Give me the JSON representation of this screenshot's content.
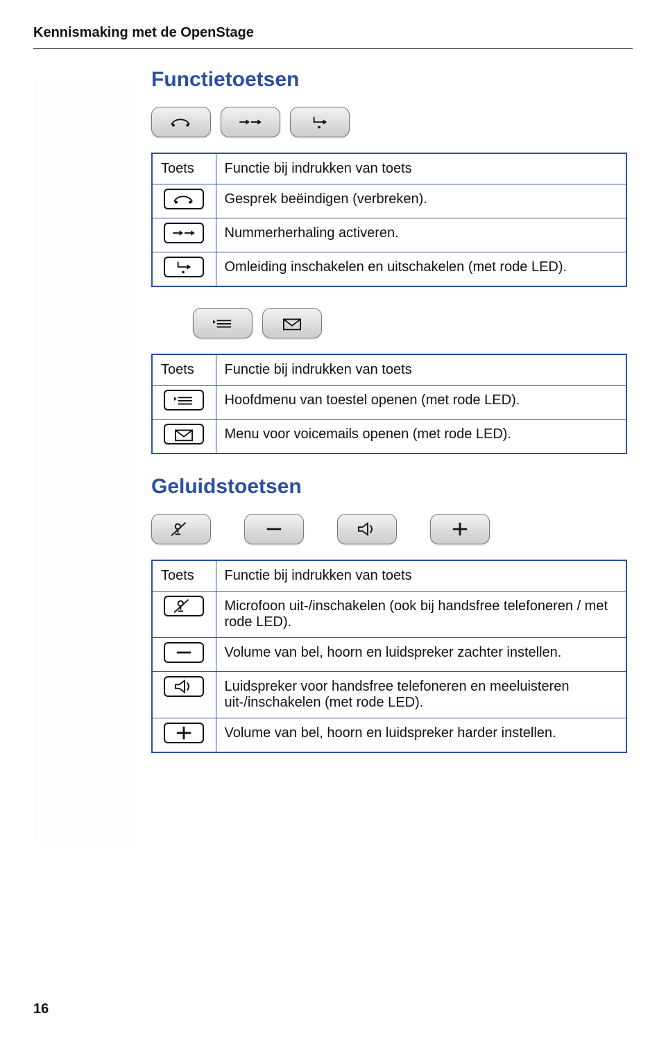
{
  "header": "Kennismaking met de OpenStage",
  "page_number": "16",
  "section1": {
    "title": "Functietoetsen",
    "buttons_image": [
      "release",
      "redial",
      "forward"
    ],
    "table1": {
      "head": [
        "Toets",
        "Functie bij indrukken van toets"
      ],
      "rows": [
        {
          "icon": "release",
          "text": "Gesprek beëindigen (verbreken)."
        },
        {
          "icon": "redial",
          "text": "Nummerherhaling activeren."
        },
        {
          "icon": "forward",
          "text": "Omleiding inschakelen en uitschakelen (met rode LED)."
        }
      ]
    },
    "buttons_image2": [
      "menu",
      "mail"
    ],
    "table2": {
      "head": [
        "Toets",
        "Functie bij indrukken van toets"
      ],
      "rows": [
        {
          "icon": "menu",
          "text": "Hoofdmenu van toestel openen (met rode LED)."
        },
        {
          "icon": "mail",
          "text": "Menu voor voicemails openen (met rode LED)."
        }
      ]
    }
  },
  "section2": {
    "title": "Geluidstoetsen",
    "buttons_image": [
      "mute",
      "minus",
      "speaker",
      "plus"
    ],
    "table": {
      "head": [
        "Toets",
        "Functie bij indrukken van toets"
      ],
      "rows": [
        {
          "icon": "mute",
          "text": "Microfoon uit-/inschakelen (ook bij handsfree telefoneren / met rode LED)."
        },
        {
          "icon": "minus",
          "text": "Volume van bel, hoorn en luidspreker zachter instellen."
        },
        {
          "icon": "speaker",
          "text": "Luidspreker voor handsfree telefoneren en meeluisteren uit-/inschakelen (met rode LED)."
        },
        {
          "icon": "plus",
          "text": "Volume van bel, hoorn en luidspreker harder instellen."
        }
      ]
    }
  }
}
